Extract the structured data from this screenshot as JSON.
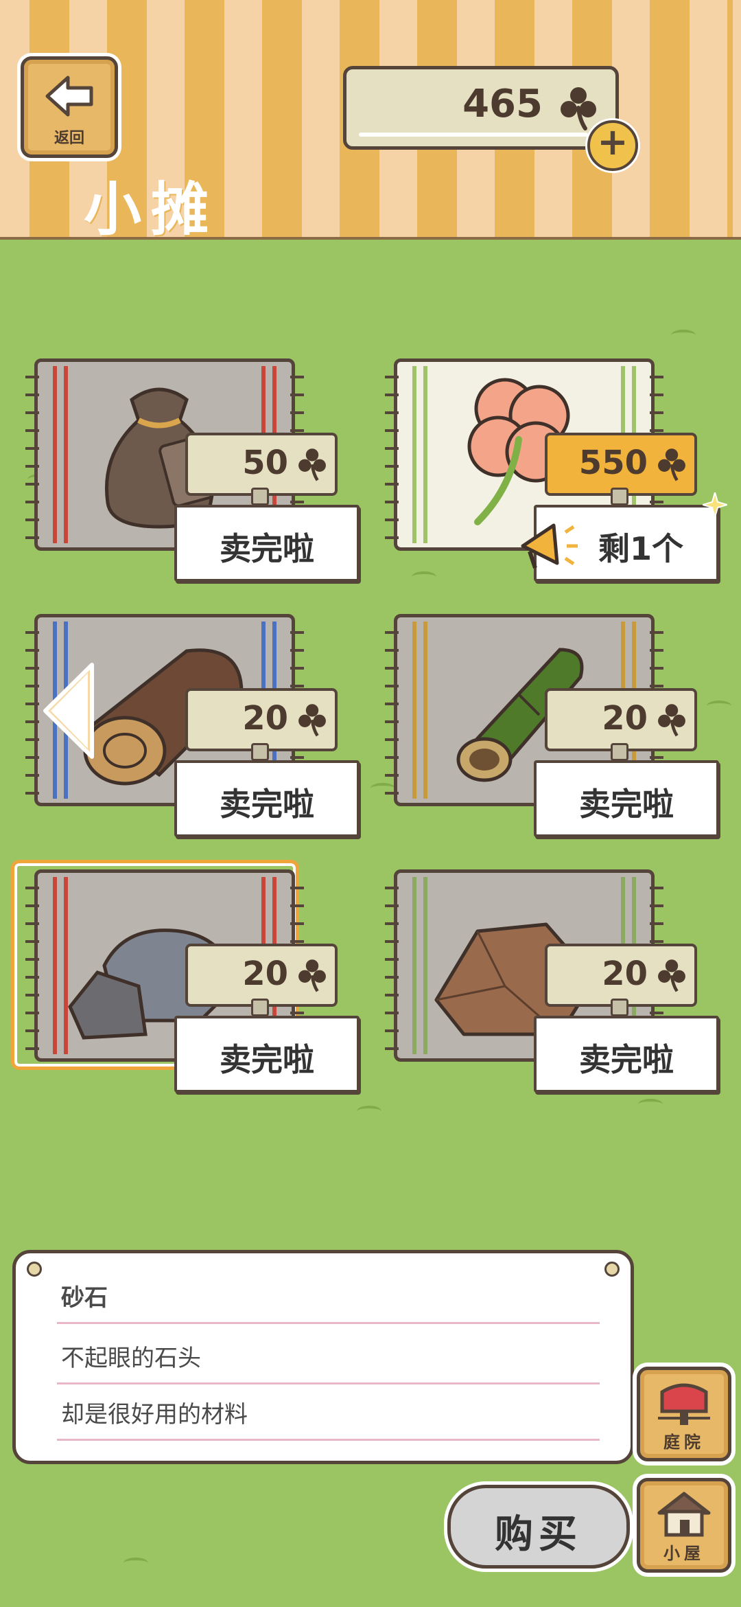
{
  "header": {
    "back_label": "返回",
    "title": "小摊",
    "clover_count": "465"
  },
  "stalls": [
    {
      "item": "bag-of-seeds",
      "price": "50",
      "status": "卖完啦",
      "rug": "gray",
      "stripe": "#c9473a",
      "highlight": false
    },
    {
      "item": "four-leaf-clover",
      "price": "550",
      "status": "剩1个",
      "rug": "light",
      "stripe": "#9fc26a",
      "highlight": true
    },
    {
      "item": "wood-log",
      "price": "20",
      "status": "卖完啦",
      "rug": "gray",
      "stripe": "#4a72c0",
      "highlight": false
    },
    {
      "item": "bamboo",
      "price": "20",
      "status": "卖完啦",
      "rug": "gray",
      "stripe": "#c79a3a",
      "highlight": false
    },
    {
      "item": "gravel-stone",
      "price": "20",
      "status": "卖完啦",
      "rug": "gray",
      "stripe": "#c9473a",
      "highlight": false,
      "selected": true
    },
    {
      "item": "clay-rock",
      "price": "20",
      "status": "卖完啦",
      "rug": "gray",
      "stripe": "#8aaa62",
      "highlight": false
    }
  ],
  "description": {
    "name": "砂石",
    "line1": "不起眼的石头",
    "line2": "却是很好用的材料"
  },
  "buttons": {
    "yard_label": "庭院",
    "house_label": "小屋",
    "buy_label": "购买"
  },
  "colors": {
    "grass": "#9bc463",
    "outline": "#55443a",
    "button_wood": "#e7b867",
    "highlight_tag": "#f2b33c"
  }
}
